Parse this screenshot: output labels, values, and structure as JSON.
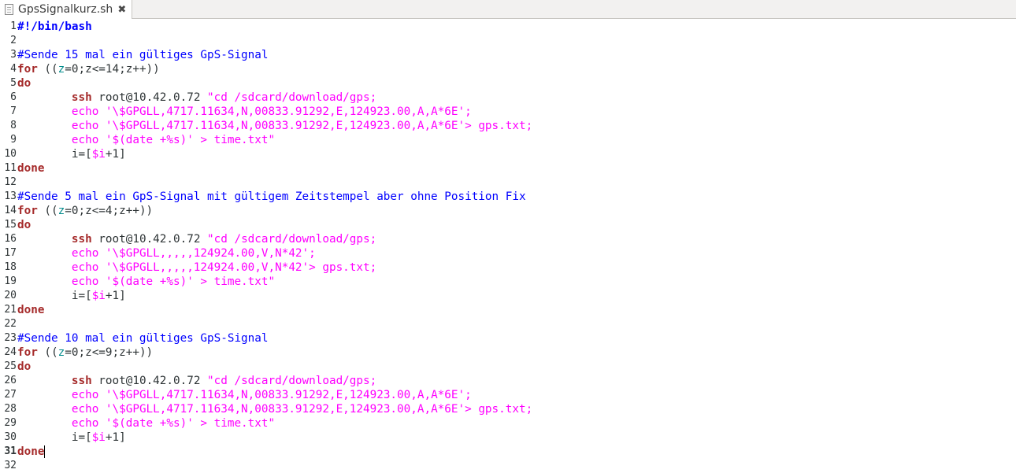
{
  "tab": {
    "title": "GpsSignalkurz.sh",
    "close_glyph": "✖"
  },
  "current_line": 31,
  "lines": [
    {
      "n": "1",
      "tokens": [
        {
          "c": "shebang",
          "t": "#!/bin/bash"
        }
      ]
    },
    {
      "n": "2",
      "tokens": []
    },
    {
      "n": "3",
      "tokens": [
        {
          "c": "comment",
          "t": "#Sende 15 mal ein gültiges GpS-Signal"
        }
      ]
    },
    {
      "n": "4",
      "tokens": [
        {
          "c": "keyword",
          "t": "for"
        },
        {
          "c": "plain",
          "t": " (("
        },
        {
          "c": "var",
          "t": "z"
        },
        {
          "c": "plain",
          "t": "=0;z<=14;z++))"
        }
      ]
    },
    {
      "n": "5",
      "tokens": [
        {
          "c": "keyword",
          "t": "do"
        }
      ]
    },
    {
      "n": "6",
      "tokens": [
        {
          "c": "plain",
          "t": "        "
        },
        {
          "c": "builtin",
          "t": "ssh"
        },
        {
          "c": "plain",
          "t": " root@10.42.0.72 "
        },
        {
          "c": "string",
          "t": "\"cd /sdcard/download/gps;"
        }
      ]
    },
    {
      "n": "7",
      "tokens": [
        {
          "c": "plain",
          "t": "        "
        },
        {
          "c": "string",
          "t": "echo '\\$GPGLL,4717.11634,N,00833.91292,E,124923.00,A,A*6E';"
        }
      ]
    },
    {
      "n": "8",
      "tokens": [
        {
          "c": "plain",
          "t": "        "
        },
        {
          "c": "string",
          "t": "echo '\\$GPGLL,4717.11634,N,00833.91292,E,124923.00,A,A*6E'> gps.txt;"
        }
      ]
    },
    {
      "n": "9",
      "tokens": [
        {
          "c": "plain",
          "t": "        "
        },
        {
          "c": "string",
          "t": "echo '$(date +%s)' > time.txt\""
        }
      ]
    },
    {
      "n": "10",
      "tokens": [
        {
          "c": "plain",
          "t": "        i=["
        },
        {
          "c": "string",
          "t": "$i"
        },
        {
          "c": "plain",
          "t": "+1]"
        }
      ]
    },
    {
      "n": "11",
      "tokens": [
        {
          "c": "keyword",
          "t": "done"
        }
      ]
    },
    {
      "n": "12",
      "tokens": []
    },
    {
      "n": "13",
      "tokens": [
        {
          "c": "comment",
          "t": "#Sende 5 mal ein GpS-Signal mit gültigem Zeitstempel aber ohne Position Fix"
        }
      ]
    },
    {
      "n": "14",
      "tokens": [
        {
          "c": "keyword",
          "t": "for"
        },
        {
          "c": "plain",
          "t": " (("
        },
        {
          "c": "var",
          "t": "z"
        },
        {
          "c": "plain",
          "t": "=0;z<=4;z++))"
        }
      ]
    },
    {
      "n": "15",
      "tokens": [
        {
          "c": "keyword",
          "t": "do"
        }
      ]
    },
    {
      "n": "16",
      "tokens": [
        {
          "c": "plain",
          "t": "        "
        },
        {
          "c": "builtin",
          "t": "ssh"
        },
        {
          "c": "plain",
          "t": " root@10.42.0.72 "
        },
        {
          "c": "string",
          "t": "\"cd /sdcard/download/gps;"
        }
      ]
    },
    {
      "n": "17",
      "tokens": [
        {
          "c": "plain",
          "t": "        "
        },
        {
          "c": "string",
          "t": "echo '\\$GPGLL,,,,,124924.00,V,N*42';"
        }
      ]
    },
    {
      "n": "18",
      "tokens": [
        {
          "c": "plain",
          "t": "        "
        },
        {
          "c": "string",
          "t": "echo '\\$GPGLL,,,,,124924.00,V,N*42'> gps.txt;"
        }
      ]
    },
    {
      "n": "19",
      "tokens": [
        {
          "c": "plain",
          "t": "        "
        },
        {
          "c": "string",
          "t": "echo '$(date +%s)' > time.txt\""
        }
      ]
    },
    {
      "n": "20",
      "tokens": [
        {
          "c": "plain",
          "t": "        i=["
        },
        {
          "c": "string",
          "t": "$i"
        },
        {
          "c": "plain",
          "t": "+1]"
        }
      ]
    },
    {
      "n": "21",
      "tokens": [
        {
          "c": "keyword",
          "t": "done"
        }
      ]
    },
    {
      "n": "22",
      "tokens": []
    },
    {
      "n": "23",
      "tokens": [
        {
          "c": "comment",
          "t": "#Sende 10 mal ein gültiges GpS-Signal"
        }
      ]
    },
    {
      "n": "24",
      "tokens": [
        {
          "c": "keyword",
          "t": "for"
        },
        {
          "c": "plain",
          "t": " (("
        },
        {
          "c": "var",
          "t": "z"
        },
        {
          "c": "plain",
          "t": "=0;z<=9;z++))"
        }
      ]
    },
    {
      "n": "25",
      "tokens": [
        {
          "c": "keyword",
          "t": "do"
        }
      ]
    },
    {
      "n": "26",
      "tokens": [
        {
          "c": "plain",
          "t": "        "
        },
        {
          "c": "builtin",
          "t": "ssh"
        },
        {
          "c": "plain",
          "t": " root@10.42.0.72 "
        },
        {
          "c": "string",
          "t": "\"cd /sdcard/download/gps;"
        }
      ]
    },
    {
      "n": "27",
      "tokens": [
        {
          "c": "plain",
          "t": "        "
        },
        {
          "c": "string",
          "t": "echo '\\$GPGLL,4717.11634,N,00833.91292,E,124923.00,A,A*6E';"
        }
      ]
    },
    {
      "n": "28",
      "tokens": [
        {
          "c": "plain",
          "t": "        "
        },
        {
          "c": "string",
          "t": "echo '\\$GPGLL,4717.11634,N,00833.91292,E,124923.00,A,A*6E'> gps.txt;"
        }
      ]
    },
    {
      "n": "29",
      "tokens": [
        {
          "c": "plain",
          "t": "        "
        },
        {
          "c": "string",
          "t": "echo '$(date +%s)' > time.txt\""
        }
      ]
    },
    {
      "n": "30",
      "tokens": [
        {
          "c": "plain",
          "t": "        i=["
        },
        {
          "c": "string",
          "t": "$i"
        },
        {
          "c": "plain",
          "t": "+1]"
        }
      ]
    },
    {
      "n": "31",
      "tokens": [
        {
          "c": "keyword",
          "t": "done"
        }
      ]
    },
    {
      "n": "32",
      "tokens": []
    }
  ]
}
